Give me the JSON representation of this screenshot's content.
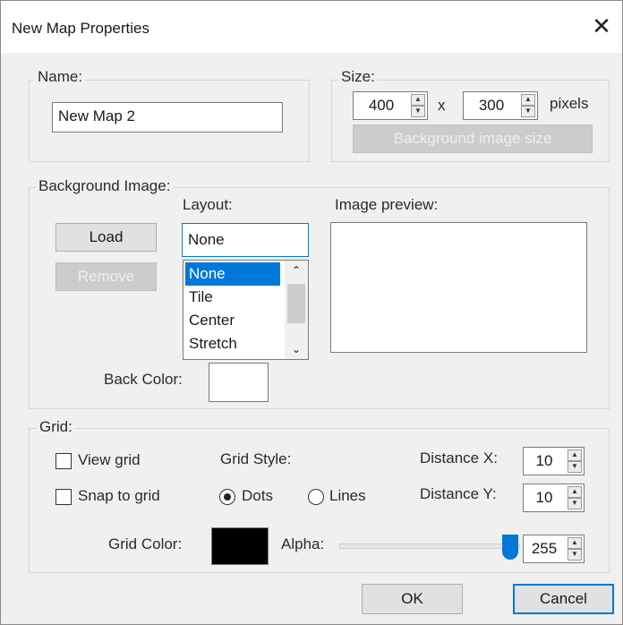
{
  "window": {
    "title": "New Map Properties",
    "close_glyph": "✕"
  },
  "name_group": {
    "label": "Name:",
    "value": "New Map 2"
  },
  "size_group": {
    "label": "Size:",
    "width": "400",
    "separator": "x",
    "height": "300",
    "unit": "pixels",
    "bg_size_button": "Background image size"
  },
  "background_group": {
    "label": "Background Image:",
    "load_button": "Load",
    "remove_button": "Remove",
    "layout_label": "Layout:",
    "layout_selected": "None",
    "layout_options": [
      "None",
      "Tile",
      "Center",
      "Stretch"
    ],
    "preview_label": "Image preview:",
    "back_color_label": "Back Color:",
    "back_color": "#ffffff"
  },
  "grid_group": {
    "label": "Grid:",
    "view_grid": "View grid",
    "snap_to_grid": "Snap to grid",
    "grid_style_label": "Grid Style:",
    "style_dots": "Dots",
    "style_lines": "Lines",
    "distance_x_label": "Distance X:",
    "distance_x": "10",
    "distance_y_label": "Distance Y:",
    "distance_y": "10",
    "grid_color_label": "Grid Color:",
    "grid_color": "#000000",
    "alpha_label": "Alpha:",
    "alpha": "255"
  },
  "footer": {
    "ok": "OK",
    "cancel": "Cancel"
  },
  "colors": {
    "accent": "#0078d7"
  }
}
